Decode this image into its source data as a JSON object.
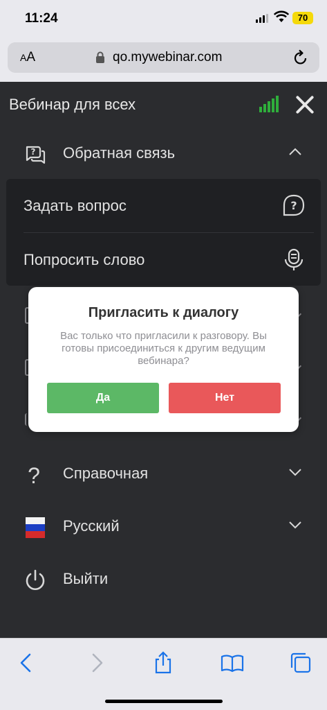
{
  "status_bar": {
    "time": "11:24",
    "battery": "70"
  },
  "browser": {
    "font_size_label_small": "A",
    "font_size_label_large": "A",
    "url": "qo.mywebinar.com"
  },
  "page": {
    "title": "Вебинар для всех",
    "menu": {
      "feedback": "Обратная связь",
      "ask_question": "Задать вопрос",
      "request_speech": "Попросить слово",
      "help": "Справочная",
      "language": "Русский",
      "logout": "Выйти"
    }
  },
  "dialog": {
    "title": "Пригласить к диалогу",
    "message": "Вас только что пригласили к разговору. Вы готовы присоединиться к другим ведущим вебинара?",
    "yes_label": "Да",
    "no_label": "Нет"
  },
  "colors": {
    "accent_green": "#5cb866",
    "accent_red": "#e9585a",
    "signal_green": "#2fae3b",
    "background_dark": "#2b2c2f"
  },
  "icons": [
    "lock-icon",
    "reload-icon",
    "signal-icon",
    "close-icon",
    "feedback-icon",
    "question-icon",
    "microphone-icon",
    "help-icon",
    "flag-ru-icon",
    "power-icon",
    "back-icon",
    "forward-icon",
    "share-icon",
    "bookmarks-icon",
    "tabs-icon"
  ]
}
